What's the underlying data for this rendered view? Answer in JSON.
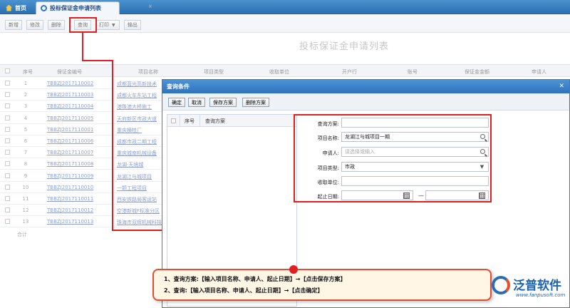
{
  "tabs": [
    {
      "label": "首页",
      "icon": "home-icon"
    },
    {
      "label": "投标保证金申请列表",
      "icon": "gear-icon"
    }
  ],
  "toolbar": {
    "buttons": [
      "新增",
      "修改",
      "删除",
      "查询",
      "打印",
      "输出"
    ]
  },
  "page": {
    "title": "投标保证金申请列表",
    "columns": [
      "序号",
      "保证金编号",
      "项目名称",
      "项目类型",
      "收取单位",
      "开户行",
      "账号",
      "保证金金额",
      "申请人"
    ],
    "rows": [
      {
        "no": "1",
        "code": "TBBZJ2017110002",
        "name": "成都蓝光高新技术"
      },
      {
        "no": "2",
        "code": "TBBZJ2017110003",
        "name": "成都火车东站工程"
      },
      {
        "no": "3",
        "code": "TBBZJ2017110004",
        "name": "港珠澳大桥施工"
      },
      {
        "no": "4",
        "code": "TBBZJ2017110005",
        "name": "天府新区市政大道"
      },
      {
        "no": "5",
        "code": "TBBZJ2017110001",
        "name": "重庆横桂厂"
      },
      {
        "no": "6",
        "code": "TBBZJ2017110006",
        "name": "成都市政二期工程"
      },
      {
        "no": "7",
        "code": "TBBZJ2017110007",
        "name": "重庆城南机械设备"
      },
      {
        "no": "8",
        "code": "TBBZJ2017110008",
        "name": "龙湖·天境城"
      },
      {
        "no": "9",
        "code": "TBBZJ2017110009",
        "name": "龙湖江与城项目"
      },
      {
        "no": "10",
        "code": "TBBZJ2017110010",
        "name": "一颗工程项目"
      },
      {
        "no": "11",
        "code": "TBBZJ2017110011",
        "name": "西安铁路局客运站"
      },
      {
        "no": "12",
        "code": "TBBZJ2017110012",
        "name": "空港新城F标准分区"
      },
      {
        "no": "13",
        "code": "TBBZJ2017110013",
        "name": "珠海市双辉机械科技"
      }
    ],
    "sum_label": "合计"
  },
  "dialog": {
    "title": "查询条件",
    "buttons": [
      "确定",
      "取消",
      "保存方案",
      "删除方案"
    ],
    "plan_list": {
      "col_no": "序号",
      "col_plan": "查询方案"
    },
    "fields": {
      "plan": {
        "label": "查询方案:",
        "value": ""
      },
      "project_name": {
        "label": "项目名称:",
        "value": "龙湖江与城项目一期"
      },
      "applicant": {
        "label": "申请人:",
        "placeholder": "请选择或输入"
      },
      "project_type": {
        "label": "项目类型:",
        "value": "市政"
      },
      "receiver": {
        "label": "收取单位:",
        "value": ""
      },
      "date": {
        "label": "起止日期:",
        "separator": "—"
      }
    }
  },
  "callout": {
    "line1": "1、查询方案:【输入项目名称、申请人、起止日期】→【点击保存方案】",
    "line2": "2、查询:【输入项目名称、申请人、起止日期】→【点击确定】"
  },
  "logo": {
    "name": "泛普软件",
    "url": "www.fanpusoft.com"
  },
  "colors": {
    "accent": "#2f72bd",
    "highlight": "#e02020",
    "link": "#8b9fd6"
  }
}
